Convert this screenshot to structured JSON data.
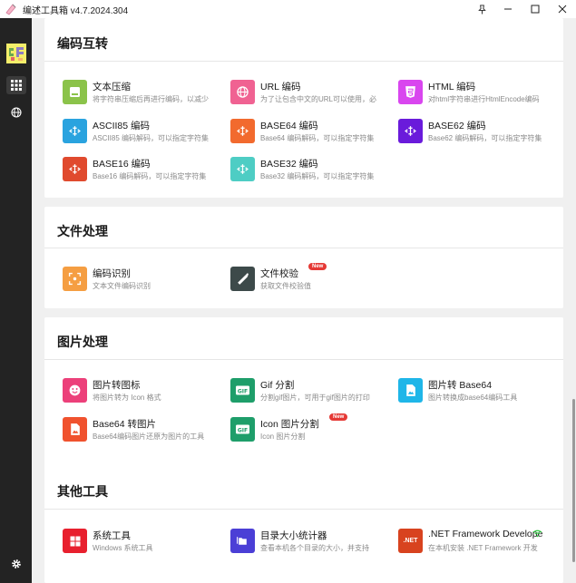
{
  "window": {
    "title": "编述工具箱 v4.7.2024.304"
  },
  "colors": {
    "sidebar": "#232323",
    "accent_badge": "#e53935"
  },
  "sections": [
    {
      "title": "编码互转",
      "tools": [
        {
          "name": "文本压缩",
          "desc": "将字符串压缩后再进行编码，以减少",
          "icon": "compress-icon",
          "color": "#8bc34a"
        },
        {
          "name": "URL 编码",
          "desc": "为了让包含中文的URL可以使用，必",
          "icon": "globe-icon",
          "color": "#f06292"
        },
        {
          "name": "HTML 编码",
          "desc": "对html字符串进行HtmlEncode编码",
          "icon": "html5-icon",
          "color": "#d946ef"
        },
        {
          "name": "ASCII85 编码",
          "desc": "ASCII85 编码解码，可以指定字符集",
          "icon": "codec-icon",
          "color": "#2aa3df"
        },
        {
          "name": "BASE64 编码",
          "desc": "Base64 编码解码，可以指定字符集",
          "icon": "codec-icon",
          "color": "#f26a2e"
        },
        {
          "name": "BASE62 编码",
          "desc": "Base62 编码解码，可以指定字符集",
          "icon": "codec-icon",
          "color": "#6a1bdb"
        },
        {
          "name": "BASE16 编码",
          "desc": "Base16 编码解码，可以指定字符集",
          "icon": "codec-icon",
          "color": "#e04a2e"
        },
        {
          "name": "BASE32 编码",
          "desc": "Base32 编码解码，可以指定字符集",
          "icon": "codec-icon",
          "color": "#4ecdc4"
        }
      ]
    },
    {
      "title": "文件处理",
      "tools": [
        {
          "name": "编码识别",
          "desc": "文本文件编码识别",
          "icon": "scan-icon",
          "color": "#f59e42"
        },
        {
          "name": "文件校验",
          "desc": "获取文件校验值",
          "icon": "saw-icon",
          "color": "#3d4a4a",
          "badge": "New"
        }
      ]
    },
    {
      "title": "图片处理",
      "tools": [
        {
          "name": "图片转图标",
          "desc": "将图片转为 Icon 格式",
          "icon": "smile-icon",
          "color": "#ec407a"
        },
        {
          "name": "Gif 分割",
          "desc": "分割gif图片，可用于gif图片的打印",
          "icon": "gif-icon",
          "color": "#1e9e6a"
        },
        {
          "name": "图片转 Base64",
          "desc": "图片转换成base64编码工具",
          "icon": "image-file-icon",
          "color": "#1fb6e8"
        },
        {
          "name": "Base64 转图片",
          "desc": "Base64编码图片还原为图片的工具",
          "icon": "image-file-icon",
          "color": "#f0522e"
        },
        {
          "name": "Icon 图片分割",
          "desc": "Icon 图片分割",
          "icon": "gif-icon",
          "color": "#1e9e6a",
          "badge": "New"
        }
      ]
    },
    {
      "title": "其他工具",
      "tools": [
        {
          "name": "系统工具",
          "desc": "Windows 系统工具",
          "icon": "windows-icon",
          "color": "#e8202e"
        },
        {
          "name": "目录大小统计器",
          "desc": "查看本机各个目录的大小，并支持",
          "icon": "folder-icon",
          "color": "#4b3fd6"
        },
        {
          "name": ".NET Framework Develope",
          "desc": "在本机安装 .NET Framework 开发",
          "icon": "dotnet-icon",
          "color": "#d8431f",
          "icon_text": ".NET"
        }
      ]
    }
  ]
}
